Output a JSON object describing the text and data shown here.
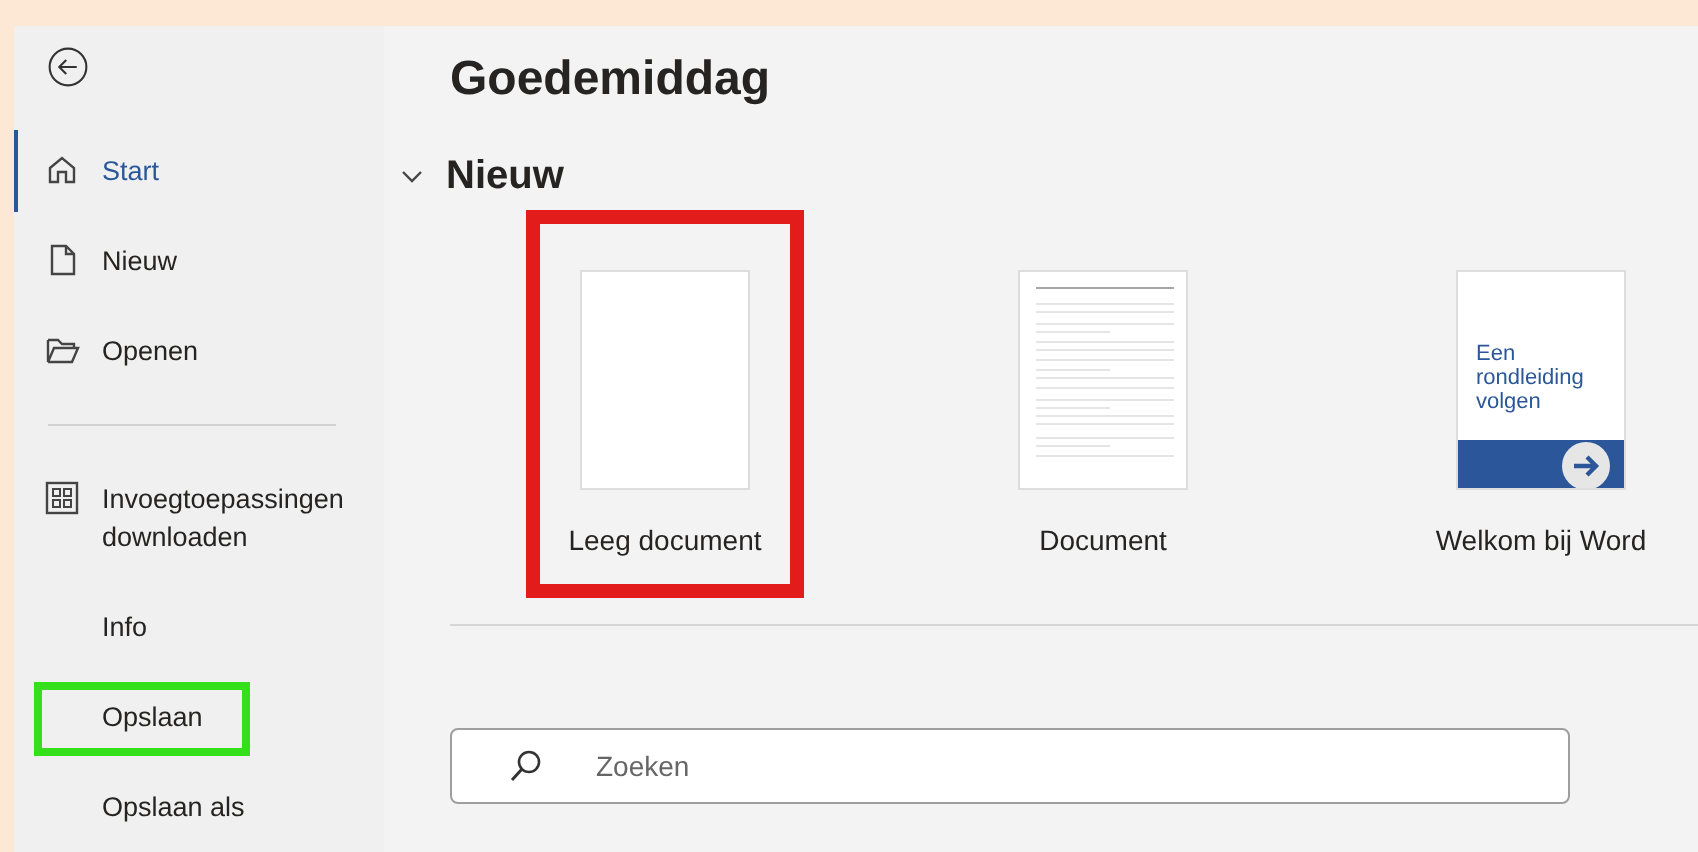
{
  "sidebar": {
    "items": [
      {
        "kind": "home",
        "label": "Start",
        "selected": true,
        "highlighted": false
      },
      {
        "kind": "page",
        "label": "Nieuw",
        "selected": false,
        "highlighted": false
      },
      {
        "kind": "folder",
        "label": "Openen",
        "selected": false,
        "highlighted": false
      },
      {
        "kind": "divider"
      },
      {
        "kind": "grid",
        "label": "Invoegtoepassingen downloaden",
        "selected": false,
        "highlighted": false
      },
      {
        "kind": "plain",
        "label": "Info",
        "selected": false,
        "highlighted": false
      },
      {
        "kind": "plain",
        "label": "Opslaan",
        "selected": false,
        "highlighted": true
      },
      {
        "kind": "plain",
        "label": "Opslaan als",
        "selected": false,
        "highlighted": false
      }
    ]
  },
  "greeting": "Goedemiddag",
  "new_section": {
    "title": "Nieuw",
    "expanded": true,
    "templates": [
      {
        "kind": "blank",
        "label": "Leeg document",
        "highlighted": true
      },
      {
        "kind": "lines",
        "label": "Document",
        "highlighted": false
      },
      {
        "kind": "tour",
        "label": "Welkom bij Word",
        "thumbnail_text": "Een rondleiding volgen",
        "highlighted": false
      }
    ]
  },
  "search": {
    "placeholder": "Zoeken"
  }
}
